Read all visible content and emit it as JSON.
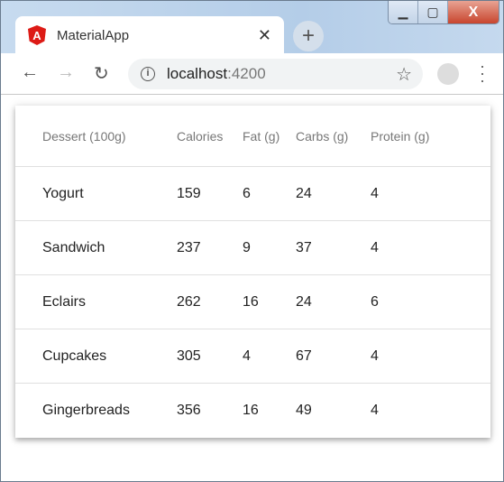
{
  "window": {
    "controls": {
      "minimize": "▁",
      "maximize": "▢",
      "close": "X"
    }
  },
  "tab": {
    "title": "MaterialApp",
    "close": "✕",
    "logo_letter": "A"
  },
  "new_tab": "+",
  "toolbar": {
    "back": "←",
    "forward": "→",
    "reload": "↻",
    "url_host": "localhost",
    "url_port": ":4200",
    "info": "i",
    "star": "☆"
  },
  "table": {
    "columns": [
      "Dessert (100g)",
      "Calories",
      "Fat (g)",
      "Carbs (g)",
      "Protein (g)"
    ],
    "rows": [
      [
        "Yogurt",
        "159",
        "6",
        "24",
        "4"
      ],
      [
        "Sandwich",
        "237",
        "9",
        "37",
        "4"
      ],
      [
        "Eclairs",
        "262",
        "16",
        "24",
        "6"
      ],
      [
        "Cupcakes",
        "305",
        "4",
        "67",
        "4"
      ],
      [
        "Gingerbreads",
        "356",
        "16",
        "49",
        "4"
      ]
    ]
  }
}
